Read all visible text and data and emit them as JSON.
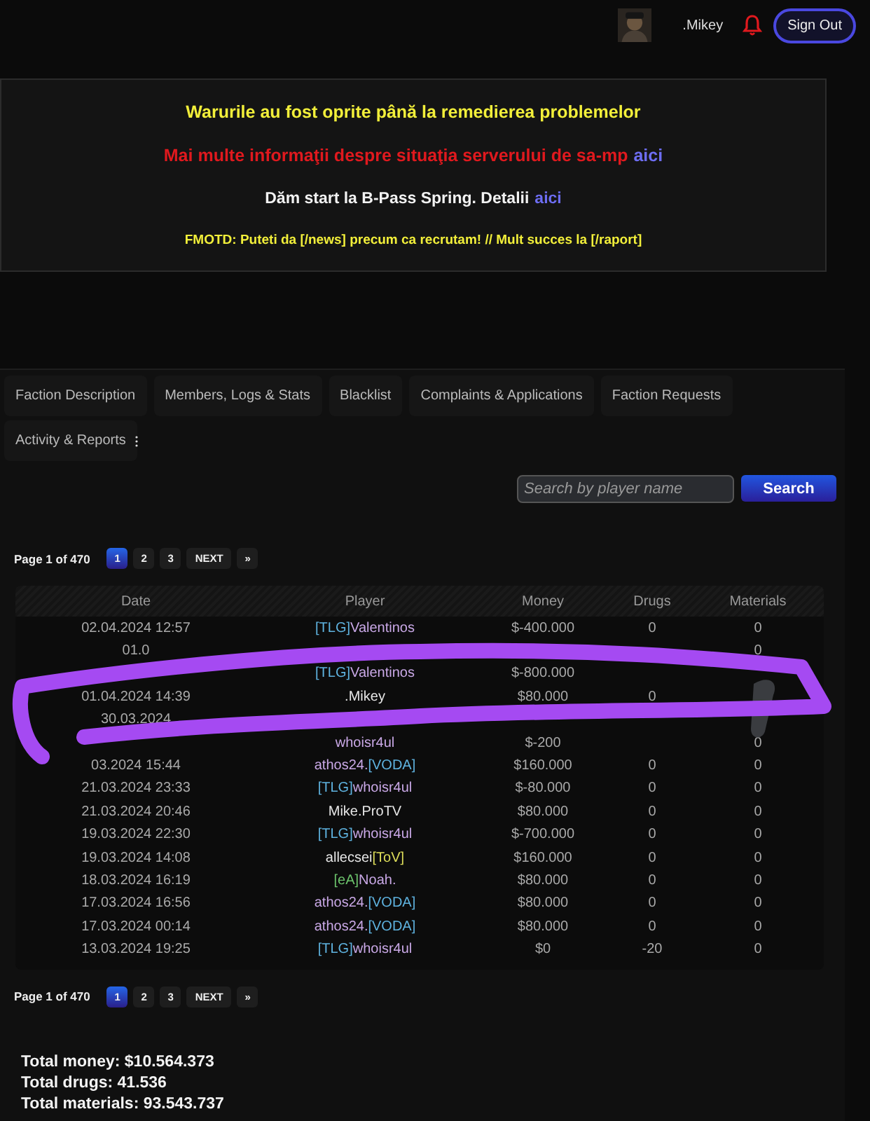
{
  "header": {
    "username": ".Mikey",
    "sign_out": "Sign Out"
  },
  "announcements": [
    {
      "kind": "large",
      "color": "#f2ef3a",
      "text": "Warurile au fost oprite până la remedierea problemelor"
    },
    {
      "kind": "large",
      "color": "#e0191e",
      "text": "Mai multe informaţii despre situaţia serverului de sa-mp",
      "link": "aici"
    },
    {
      "kind": "medium",
      "color": "#f2f2f2",
      "text": "Dăm start la B-Pass Spring. Detalii",
      "link": "aici"
    },
    {
      "kind": "small",
      "color": "#f2ef3a",
      "text": "FMOTD: Puteti da [/news] precum ca recrutam! // Mult succes la [/raport]"
    }
  ],
  "tabs": [
    "Faction Description",
    "Members, Logs & Stats",
    "Blacklist",
    "Complaints & Applications",
    "Faction Requests",
    "Activity & Reports"
  ],
  "search": {
    "placeholder": "Search by player name",
    "button": "Search"
  },
  "pagination_top": {
    "info": "Page 1 of 470",
    "pages": [
      {
        "label": "1",
        "selected": true
      },
      {
        "label": "2",
        "selected": false
      },
      {
        "label": "3",
        "selected": false
      }
    ],
    "next": "NEXT",
    "last": "»"
  },
  "table": {
    "columns": [
      "Date",
      "Player",
      "Money",
      "Drugs",
      "Materials"
    ],
    "rows": [
      {
        "date": "02.04.2024 12:57",
        "player": [
          {
            "text": "[TLG]",
            "color": "#5fb3e0"
          },
          {
            "text": "Valentinos",
            "color": "#c9a8e6"
          }
        ],
        "money": "$-400.000",
        "drugs": "0",
        "materials": "0"
      },
      {
        "date": "01.0",
        "player": [],
        "money": null,
        "drugs": null,
        "materials": "0"
      },
      {
        "date": null,
        "player": [
          {
            "text": "[TLG]",
            "color": "#5fb3e0"
          },
          {
            "text": "Valentinos",
            "color": "#c9a8e6"
          }
        ],
        "money": "$-800.000",
        "drugs": null,
        "materials": null
      },
      {
        "date": "01.04.2024 14:39",
        "player": [
          {
            "text": ".Mikey",
            "color": "#e6e6e6"
          }
        ],
        "money": "$80.000",
        "drugs": "0",
        "materials": null
      },
      {
        "date": "30.03.2024",
        "player": [],
        "money": null,
        "drugs": null,
        "materials": null
      },
      {
        "date": null,
        "player": [
          {
            "text": "whoisr4ul",
            "color": "#c9a8e6"
          }
        ],
        "money": "$-200",
        "drugs": null,
        "materials": "0"
      },
      {
        "date": "03.2024 15:44",
        "player": [
          {
            "text": "athos24.",
            "color": "#c9a8e6"
          },
          {
            "text": "[VODA]",
            "color": "#5fb3e0"
          }
        ],
        "money": "$160.000",
        "drugs": "0",
        "materials": "0"
      },
      {
        "date": "21.03.2024 23:33",
        "player": [
          {
            "text": "[TLG]",
            "color": "#5fb3e0"
          },
          {
            "text": "whoisr4ul",
            "color": "#c9a8e6"
          }
        ],
        "money": "$-80.000",
        "drugs": "0",
        "materials": "0"
      },
      {
        "date": "21.03.2024 20:46",
        "player": [
          {
            "text": "Mike.ProTV",
            "color": "#e6e6e6"
          }
        ],
        "money": "$80.000",
        "drugs": "0",
        "materials": "0"
      },
      {
        "date": "19.03.2024 22:30",
        "player": [
          {
            "text": "[TLG]",
            "color": "#5fb3e0"
          },
          {
            "text": "whoisr4ul",
            "color": "#c9a8e6"
          }
        ],
        "money": "$-700.000",
        "drugs": "0",
        "materials": "0"
      },
      {
        "date": "19.03.2024 14:08",
        "player": [
          {
            "text": "allecsei",
            "color": "#e6e6e6"
          },
          {
            "text": "[ToV]",
            "color": "#dede5a"
          }
        ],
        "money": "$160.000",
        "drugs": "0",
        "materials": "0"
      },
      {
        "date": "18.03.2024 16:19",
        "player": [
          {
            "text": "[eA]",
            "color": "#6cc46c"
          },
          {
            "text": "Noah.",
            "color": "#c9a8e6"
          }
        ],
        "money": "$80.000",
        "drugs": "0",
        "materials": "0"
      },
      {
        "date": "17.03.2024 16:56",
        "player": [
          {
            "text": "athos24.",
            "color": "#c9a8e6"
          },
          {
            "text": "[VODA]",
            "color": "#5fb3e0"
          }
        ],
        "money": "$80.000",
        "drugs": "0",
        "materials": "0"
      },
      {
        "date": "17.03.2024 00:14",
        "player": [
          {
            "text": "athos24.",
            "color": "#c9a8e6"
          },
          {
            "text": "[VODA]",
            "color": "#5fb3e0"
          }
        ],
        "money": "$80.000",
        "drugs": "0",
        "materials": "0"
      },
      {
        "date": "13.03.2024 19:25",
        "player": [
          {
            "text": "[TLG]",
            "color": "#5fb3e0"
          },
          {
            "text": "whoisr4ul",
            "color": "#c9a8e6"
          }
        ],
        "money": "$0",
        "drugs": "-20",
        "materials": "0"
      }
    ]
  },
  "pagination_bottom": {
    "info": "Page 1 of 470",
    "pages": [
      {
        "label": "1",
        "selected": true
      },
      {
        "label": "2",
        "selected": false
      },
      {
        "label": "3",
        "selected": false
      }
    ],
    "next": "NEXT",
    "last": "»"
  },
  "totals": [
    "Total money: $10.564.373",
    "Total drugs: 41.536",
    "Total materials: 93.543.737"
  ]
}
